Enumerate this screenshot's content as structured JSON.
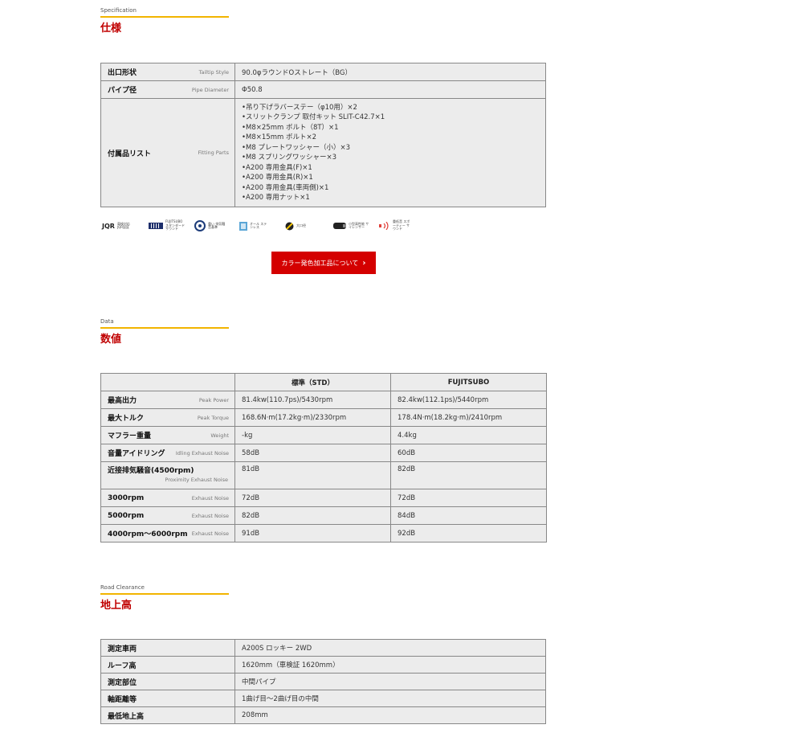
{
  "spec_section": {
    "en": "Specification",
    "jp": "仕様"
  },
  "spec_rows": [
    {
      "label": "出口形状",
      "en": "Tailtip Style",
      "value": "90.0φラウンドOストレート（BG）"
    },
    {
      "label": "パイプ径",
      "en": "Pipe Diameter",
      "value": "Φ50.8"
    }
  ],
  "fitting": {
    "label": "付属品リスト",
    "en": "Fitting Parts",
    "items": [
      "•吊り下げラバーステー（φ10用）×2",
      "•スリットクランプ 取付キット SLIT-C42.7×1",
      "•M8×25mm ボルト（8T）×1",
      "•M8×15mm ボルト×2",
      "•M8 プレートワッシャー（小）×3",
      "•M8 スプリングワッシャー×3",
      "•A200 専用金具(F)×1",
      "•A200 専用金具(R)×1",
      "•A200 専用金具(車両側)×1",
      "•A200 専用ナット×1"
    ]
  },
  "logos": [
    {
      "name": "jqr-logo",
      "mark": "JQR",
      "text": "車検対応 JQR認証"
    },
    {
      "name": "fujitsubo-sound-logo",
      "mark": "",
      "text": "FUJITSUBO スタンダード サウンド"
    },
    {
      "name": "pipe-logo",
      "mark": "",
      "text": "重い 排気騒音基準"
    },
    {
      "name": "stainless-logo",
      "mark": "",
      "text": "オール ステンレス"
    },
    {
      "name": "oval-logo",
      "mark": "",
      "text": "大口径"
    },
    {
      "name": "silencer-logo",
      "mark": "",
      "text": "小型高性能 サイレンサー"
    },
    {
      "name": "sound-logo",
      "mark": "",
      "text": "重低音 スポーティー サウンド"
    }
  ],
  "color_button": {
    "label": "カラー発色加工品について",
    "chevron": "›"
  },
  "data_section": {
    "en": "Data",
    "jp": "数値"
  },
  "data_table": {
    "headers": [
      "",
      "標準（STD）",
      "FUJITSUBO"
    ],
    "rows": [
      {
        "label": "最高出力",
        "en": "Peak Power",
        "std": "81.4kw(110.7ps)/5430rpm",
        "fuji": "82.4kw(112.1ps)/5440rpm"
      },
      {
        "label": "最大トルク",
        "en": "Peak Torque",
        "std": "168.6N·m(17.2kg·m)/2330rpm",
        "fuji": "178.4N·m(18.2kg·m)/2410rpm"
      },
      {
        "label": "マフラー重量",
        "en": "Weight",
        "std": "-kg",
        "fuji": "4.4kg"
      },
      {
        "label": "音量アイドリング",
        "en": "Idling Exhaust Noise",
        "std": "58dB",
        "fuji": "60dB"
      },
      {
        "label": "近接排気騒音(4500rpm)",
        "en": "Proximity Exhaust Noise",
        "std": "81dB",
        "fuji": "82dB"
      },
      {
        "label": "3000rpm",
        "en": "Exhaust Noise",
        "std": "72dB",
        "fuji": "72dB"
      },
      {
        "label": "5000rpm",
        "en": "Exhaust Noise",
        "std": "82dB",
        "fuji": "84dB"
      },
      {
        "label": "4000rpm〜6000rpm",
        "en": "Exhaust Noise",
        "std": "91dB",
        "fuji": "92dB"
      }
    ]
  },
  "road_section": {
    "en": "Road Clearance",
    "jp": "地上高"
  },
  "road_table": [
    {
      "label": "測定車両",
      "value": "A200S ロッキー 2WD"
    },
    {
      "label": "ルーフ高",
      "value": "1620mm（車検証 1620mm）"
    },
    {
      "label": "測定部位",
      "value": "中間パイプ"
    },
    {
      "label": "軸距離等",
      "value": "1曲げ目〜2曲げ目の中間"
    },
    {
      "label": "最低地上高",
      "value": "208mm"
    }
  ],
  "colors": {
    "accent_red": "#c00000",
    "rule_yellow": "#f2b400",
    "button_red": "#d40000"
  }
}
